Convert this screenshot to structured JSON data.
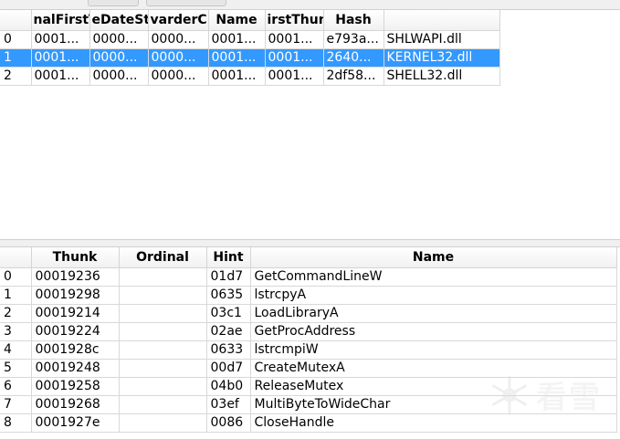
{
  "imports_table": {
    "columns": [
      "",
      "nalFirstT",
      "eDateSta",
      "varderC",
      "Name",
      "irstThun",
      "Hash",
      ""
    ],
    "rows": [
      {
        "index": "0",
        "c1": "0001...",
        "c2": "0000...",
        "c3": "0000...",
        "c4": "0001...",
        "c5": "0001...",
        "c6": "e793a...",
        "c7": "SHLWAPI.dll",
        "selected": false
      },
      {
        "index": "1",
        "c1": "0001...",
        "c2": "0000...",
        "c3": "0000...",
        "c4": "0001...",
        "c5": "0001...",
        "c6": "2640...",
        "c7": "KERNEL32.dll",
        "selected": true
      },
      {
        "index": "2",
        "c1": "0001...",
        "c2": "0000...",
        "c3": "0000...",
        "c4": "0001...",
        "c5": "0001...",
        "c6": "2df58...",
        "c7": "SHELL32.dll",
        "selected": false
      }
    ]
  },
  "functions_table": {
    "columns": [
      "",
      "Thunk",
      "Ordinal",
      "Hint",
      "Name"
    ],
    "rows": [
      {
        "index": "0",
        "thunk": "00019236",
        "ordinal": "",
        "hint": "01d7",
        "name": "GetCommandLineW"
      },
      {
        "index": "1",
        "thunk": "00019298",
        "ordinal": "",
        "hint": "0635",
        "name": "lstrcpyA"
      },
      {
        "index": "2",
        "thunk": "00019214",
        "ordinal": "",
        "hint": "03c1",
        "name": "LoadLibraryA"
      },
      {
        "index": "3",
        "thunk": "00019224",
        "ordinal": "",
        "hint": "02ae",
        "name": "GetProcAddress"
      },
      {
        "index": "4",
        "thunk": "0001928c",
        "ordinal": "",
        "hint": "0633",
        "name": "lstrcmpiW"
      },
      {
        "index": "5",
        "thunk": "00019248",
        "ordinal": "",
        "hint": "00d7",
        "name": "CreateMutexA"
      },
      {
        "index": "6",
        "thunk": "00019258",
        "ordinal": "",
        "hint": "04b0",
        "name": "ReleaseMutex"
      },
      {
        "index": "7",
        "thunk": "00019268",
        "ordinal": "",
        "hint": "03ef",
        "name": "MultiByteToWideChar"
      },
      {
        "index": "8",
        "thunk": "0001927e",
        "ordinal": "",
        "hint": "0086",
        "name": "CloseHandle"
      }
    ]
  },
  "watermark": {
    "text": "看雪",
    "icon": "snowflake-logo-icon"
  },
  "colors": {
    "selection": "#3399ff",
    "grid": "#d8d8d8",
    "header_bg": "#f1f1f1"
  }
}
